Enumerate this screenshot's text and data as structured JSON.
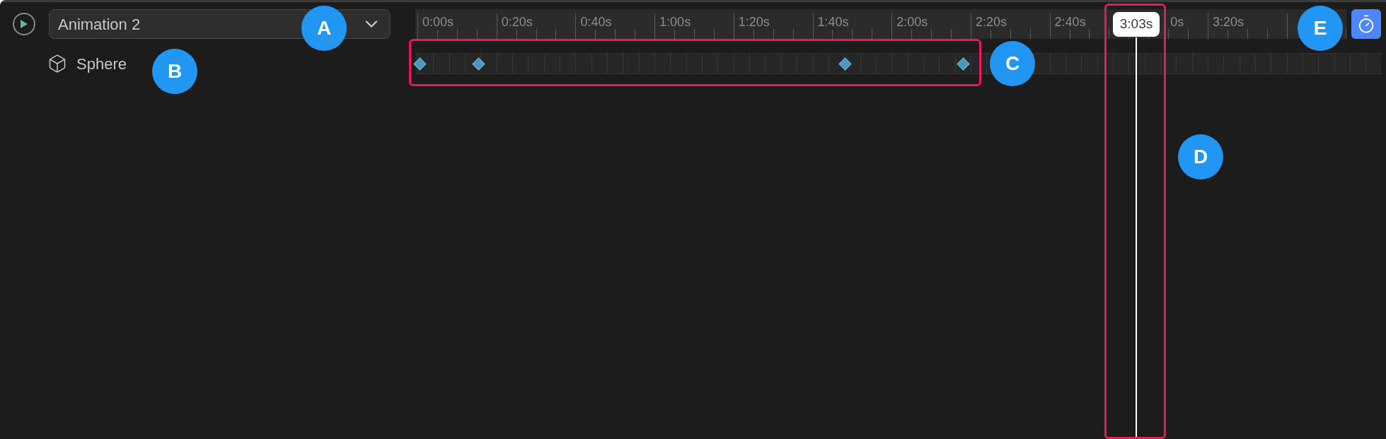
{
  "animation_select": {
    "value": "Animation 2"
  },
  "ruler": {
    "labels": [
      {
        "text": "0:00s",
        "kind": "tick"
      },
      {
        "text": "0:20s",
        "kind": "tick"
      },
      {
        "text": "0:40s",
        "kind": "tick"
      },
      {
        "text": "1:00s",
        "kind": "tick"
      },
      {
        "text": "1:20s",
        "kind": "tick"
      },
      {
        "text": "1:40s",
        "kind": "tick"
      },
      {
        "text": "2:00s",
        "kind": "tick"
      },
      {
        "text": "2:20s",
        "kind": "tick"
      },
      {
        "text": "2:40s",
        "kind": "tick"
      },
      {
        "text": "0s",
        "kind": "covered"
      },
      {
        "text": "3:20s",
        "kind": "tick"
      }
    ]
  },
  "tracks": [
    {
      "name": "Sphere",
      "keyframes": [
        {
          "level": 0.0044
        },
        {
          "level": 0.065
        },
        {
          "level": 0.445
        },
        {
          "level": 0.567
        }
      ]
    }
  ],
  "playhead": {
    "time": "3:03s",
    "level": 0.7465
  },
  "annotations": [
    {
      "label": "A"
    },
    {
      "label": "B"
    },
    {
      "label": "C"
    },
    {
      "label": "D"
    },
    {
      "label": "E"
    }
  ]
}
